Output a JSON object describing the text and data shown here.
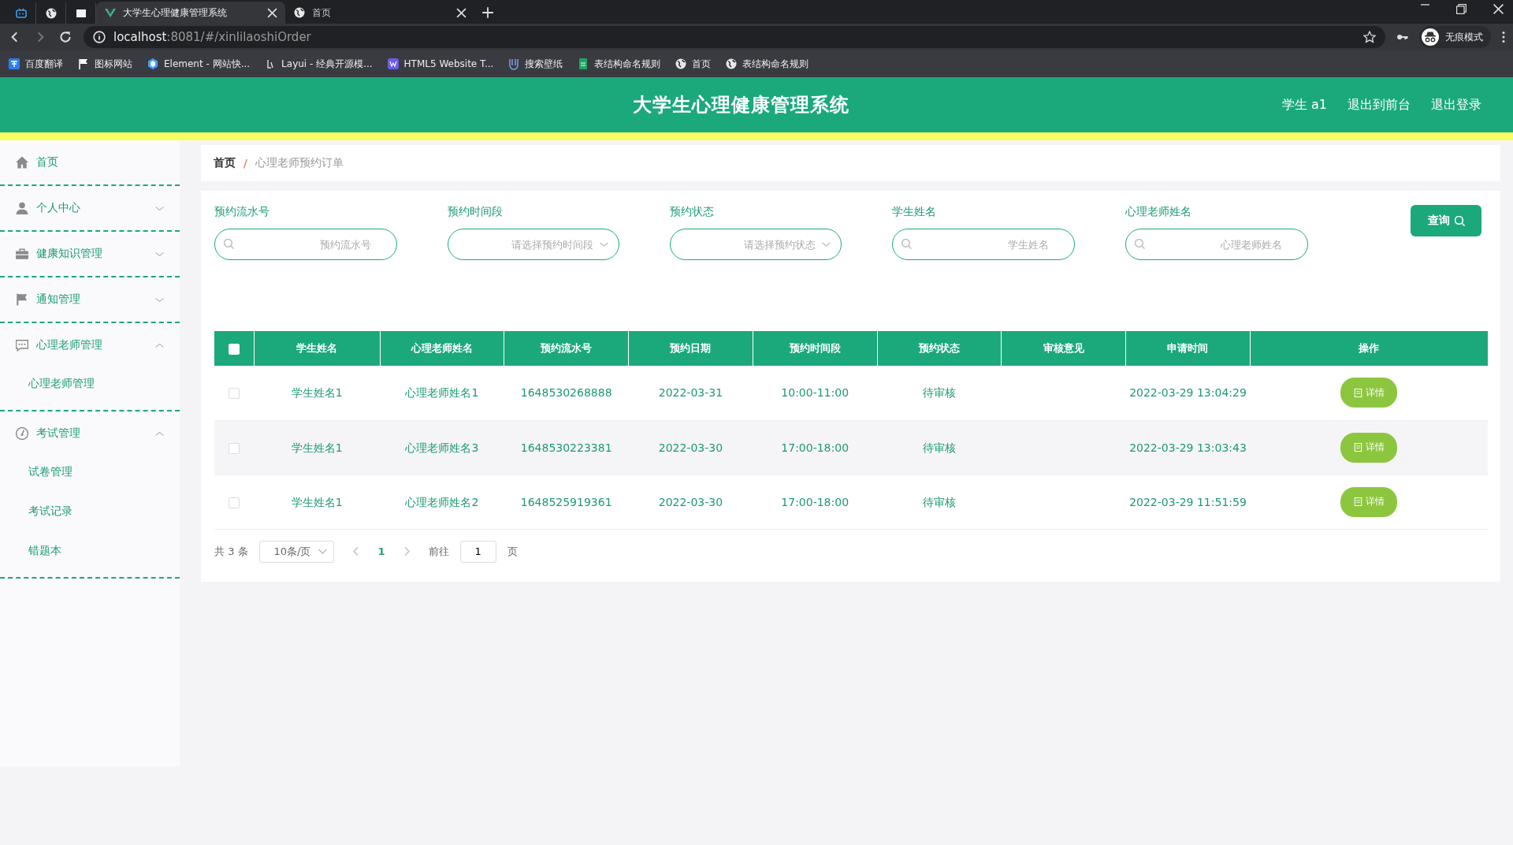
{
  "browser": {
    "pinned_tabs": [
      {
        "kind": "tv"
      },
      {
        "kind": "globe"
      },
      {
        "kind": "page"
      }
    ],
    "tabs": [
      {
        "title": "大学生心理健康管理系统",
        "selected": true
      },
      {
        "title": "首页",
        "selected": false
      }
    ],
    "address": {
      "host": "localhost",
      "rest": ":8081/#/xinlilaoshiOrder"
    },
    "bookmarks": [
      "百度翻译",
      "图标网站",
      "Element - 网站快...",
      "Layui - 经典开源模...",
      "HTML5 Website T...",
      "搜索壁纸",
      "表结构命名规则",
      "首页",
      "表结构命名规则"
    ],
    "profile": "无痕模式"
  },
  "header": {
    "title": "大学生心理健康管理系统",
    "user": "学生 a1",
    "links": [
      "退出到前台",
      "退出登录"
    ]
  },
  "sidebar": {
    "items": [
      {
        "label": "首页",
        "kind": "link"
      },
      {
        "label": "个人中心",
        "kind": "menu",
        "expanded": false
      },
      {
        "label": "健康知识管理",
        "kind": "menu",
        "expanded": false
      },
      {
        "label": "通知管理",
        "kind": "menu",
        "expanded": false
      },
      {
        "label": "心理老师管理",
        "kind": "menu",
        "expanded": true,
        "children": [
          {
            "label": "心理老师管理"
          }
        ]
      },
      {
        "label": "考试管理",
        "kind": "menu",
        "expanded": true,
        "children": [
          {
            "label": "试卷管理"
          },
          {
            "label": "考试记录"
          },
          {
            "label": "错题本"
          }
        ]
      }
    ]
  },
  "breadcrumb": {
    "items": [
      "首页",
      "心理老师预约订单"
    ],
    "separator": "/"
  },
  "filters": [
    {
      "label": "预约流水号",
      "placeholder": "预约流水号",
      "kind": "search"
    },
    {
      "label": "预约时间段",
      "placeholder": "请选择预约时间段",
      "kind": "select"
    },
    {
      "label": "预约状态",
      "placeholder": "请选择预约状态",
      "kind": "select"
    },
    {
      "label": "学生姓名",
      "placeholder": "学生姓名",
      "kind": "search"
    },
    {
      "label": "心理老师姓名",
      "placeholder": "心理老师姓名",
      "kind": "search"
    }
  ],
  "search_button": "查询",
  "table": {
    "header_checked": false,
    "columns": [
      "学生姓名",
      "心理老师姓名",
      "预约流水号",
      "预约日期",
      "预约时间段",
      "预约状态",
      "审核意见",
      "申请时间",
      "操作"
    ],
    "rows": [
      {
        "checked": false,
        "cells": [
          "学生姓名1",
          "心理老师姓名1",
          "1648530268888",
          "2022-03-31",
          "10:00-11:00",
          "待审核",
          "",
          "2022-03-29 13:04:29"
        ],
        "action": "详情"
      },
      {
        "checked": false,
        "cells": [
          "学生姓名1",
          "心理老师姓名3",
          "1648530223381",
          "2022-03-30",
          "17:00-18:00",
          "待审核",
          "",
          "2022-03-29 13:03:43"
        ],
        "action": "详情"
      },
      {
        "checked": false,
        "cells": [
          "学生姓名1",
          "心理老师姓名2",
          "1648525919361",
          "2022-03-30",
          "17:00-18:00",
          "待审核",
          "",
          "2022-03-29 11:51:59"
        ],
        "action": "详情"
      }
    ]
  },
  "pagination": {
    "total": "共 3 条",
    "page_size": "10条/页",
    "pages": [
      {
        "label": "1",
        "selected": true
      }
    ],
    "goto_label": "前往",
    "goto_value": "1",
    "goto_suffix": "页"
  }
}
